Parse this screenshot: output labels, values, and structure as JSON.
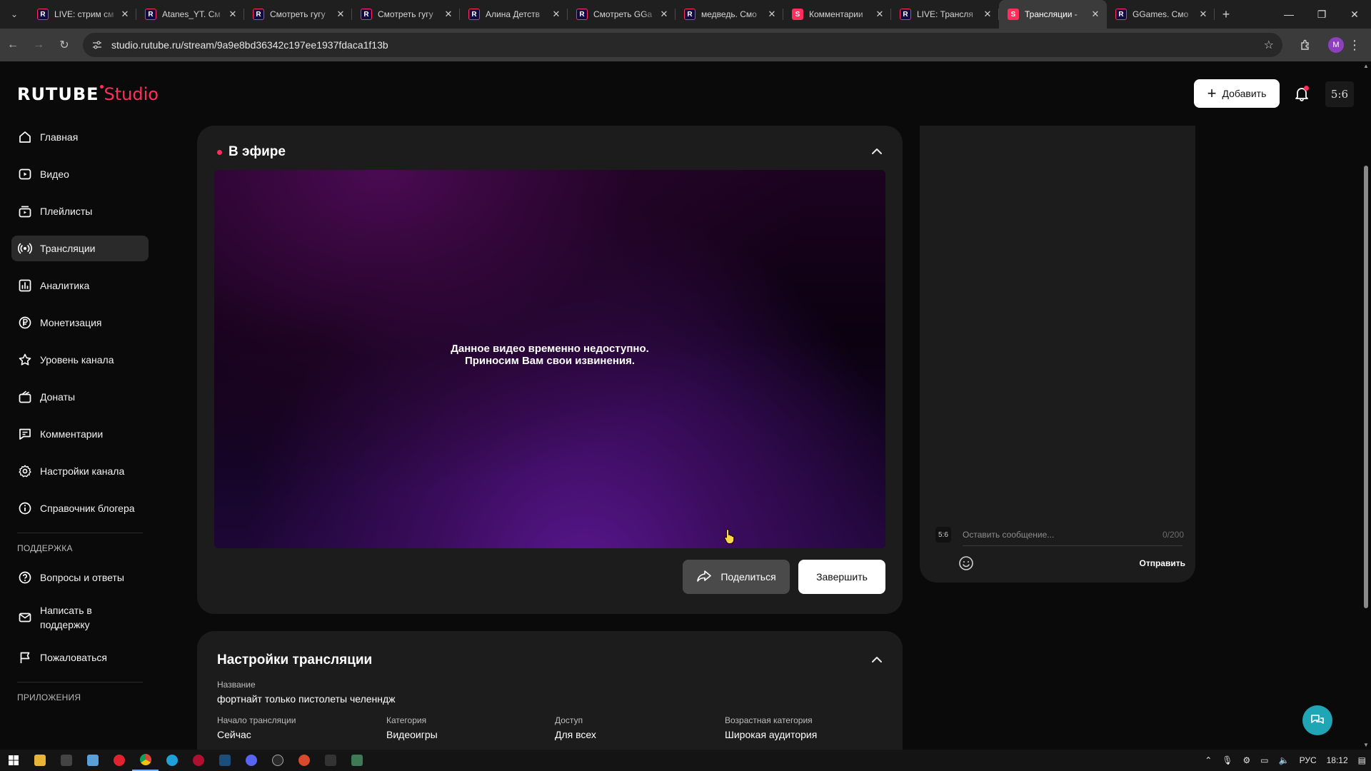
{
  "browser": {
    "tabs": [
      {
        "favicon": "R",
        "title": "LIVE: стрим см",
        "active": false
      },
      {
        "favicon": "R",
        "title": "Atanes_YT. См",
        "active": false
      },
      {
        "favicon": "R",
        "title": "Смотреть гугу",
        "active": false
      },
      {
        "favicon": "R",
        "title": "Смотреть гугу",
        "active": false
      },
      {
        "favicon": "R",
        "title": "Алина Детств",
        "active": false
      },
      {
        "favicon": "R",
        "title": "Смотреть GGa",
        "active": false
      },
      {
        "favicon": "R",
        "title": "медведь. Смо",
        "active": false
      },
      {
        "favicon": "S",
        "title": "Комментарии",
        "active": false
      },
      {
        "favicon": "R",
        "title": "LIVE: Трансля",
        "active": false
      },
      {
        "favicon": "S",
        "title": "Трансляции - ",
        "active": true
      },
      {
        "favicon": "R",
        "title": "GGames. Смо",
        "active": false
      }
    ],
    "url": "studio.rutube.ru/stream/9a9e8bd36342c197ee1937fdaca1f13b",
    "profile_initial": "M"
  },
  "header": {
    "logo_brand": "RUTUBE",
    "logo_product": "Studio",
    "add_button": "Добавить",
    "avatar_text": "5:6"
  },
  "sidebar": {
    "items": [
      {
        "label": "Главная",
        "icon": "home-icon"
      },
      {
        "label": "Видео",
        "icon": "video-icon"
      },
      {
        "label": "Плейлисты",
        "icon": "playlist-icon"
      },
      {
        "label": "Трансляции",
        "icon": "broadcast-icon",
        "active": true
      },
      {
        "label": "Аналитика",
        "icon": "analytics-icon"
      },
      {
        "label": "Монетизация",
        "icon": "ruble-icon"
      },
      {
        "label": "Уровень канала",
        "icon": "star-icon"
      },
      {
        "label": "Донаты",
        "icon": "gift-icon"
      },
      {
        "label": "Комментарии",
        "icon": "comment-icon"
      },
      {
        "label": "Настройки канала",
        "icon": "gear-icon"
      },
      {
        "label": "Справочник блогера",
        "icon": "info-icon"
      }
    ],
    "support_title": "ПОДДЕРЖКА",
    "support_items": [
      {
        "label": "Вопросы и ответы",
        "icon": "question-icon"
      },
      {
        "label": "Написать в поддержку",
        "icon": "mail-icon"
      },
      {
        "label": "Пожаловаться",
        "icon": "flag-icon"
      }
    ],
    "apps_title": "ПРИЛОЖЕНИЯ"
  },
  "live": {
    "title": "В эфире",
    "video_message_line1": "Данное видео временно недоступно.",
    "video_message_line2": "Приносим Вам свои извинения.",
    "share_button": "Поделиться",
    "finish_button": "Завершить"
  },
  "chat": {
    "placeholder": "Оставить сообщение...",
    "counter": "0/200",
    "send": "Отправить",
    "avatar_text": "5:6"
  },
  "settings": {
    "title": "Настройки трансляции",
    "name_label": "Название",
    "name_value": "фортнайт только пистолеты челенндж",
    "fields": [
      {
        "label": "Начало трансляции",
        "value": "Сейчас"
      },
      {
        "label": "Категория",
        "value": "Видеоигры"
      },
      {
        "label": "Доступ",
        "value": "Для всех"
      },
      {
        "label": "Возрастная категория",
        "value": "Широкая аудитория"
      }
    ]
  },
  "taskbar": {
    "lang": "РУС",
    "time": "18:12"
  },
  "colors": {
    "accent": "#ff2e5a",
    "background": "#0a0a0a",
    "card": "#1c1c1c",
    "help_fab": "#1fa5b4"
  }
}
